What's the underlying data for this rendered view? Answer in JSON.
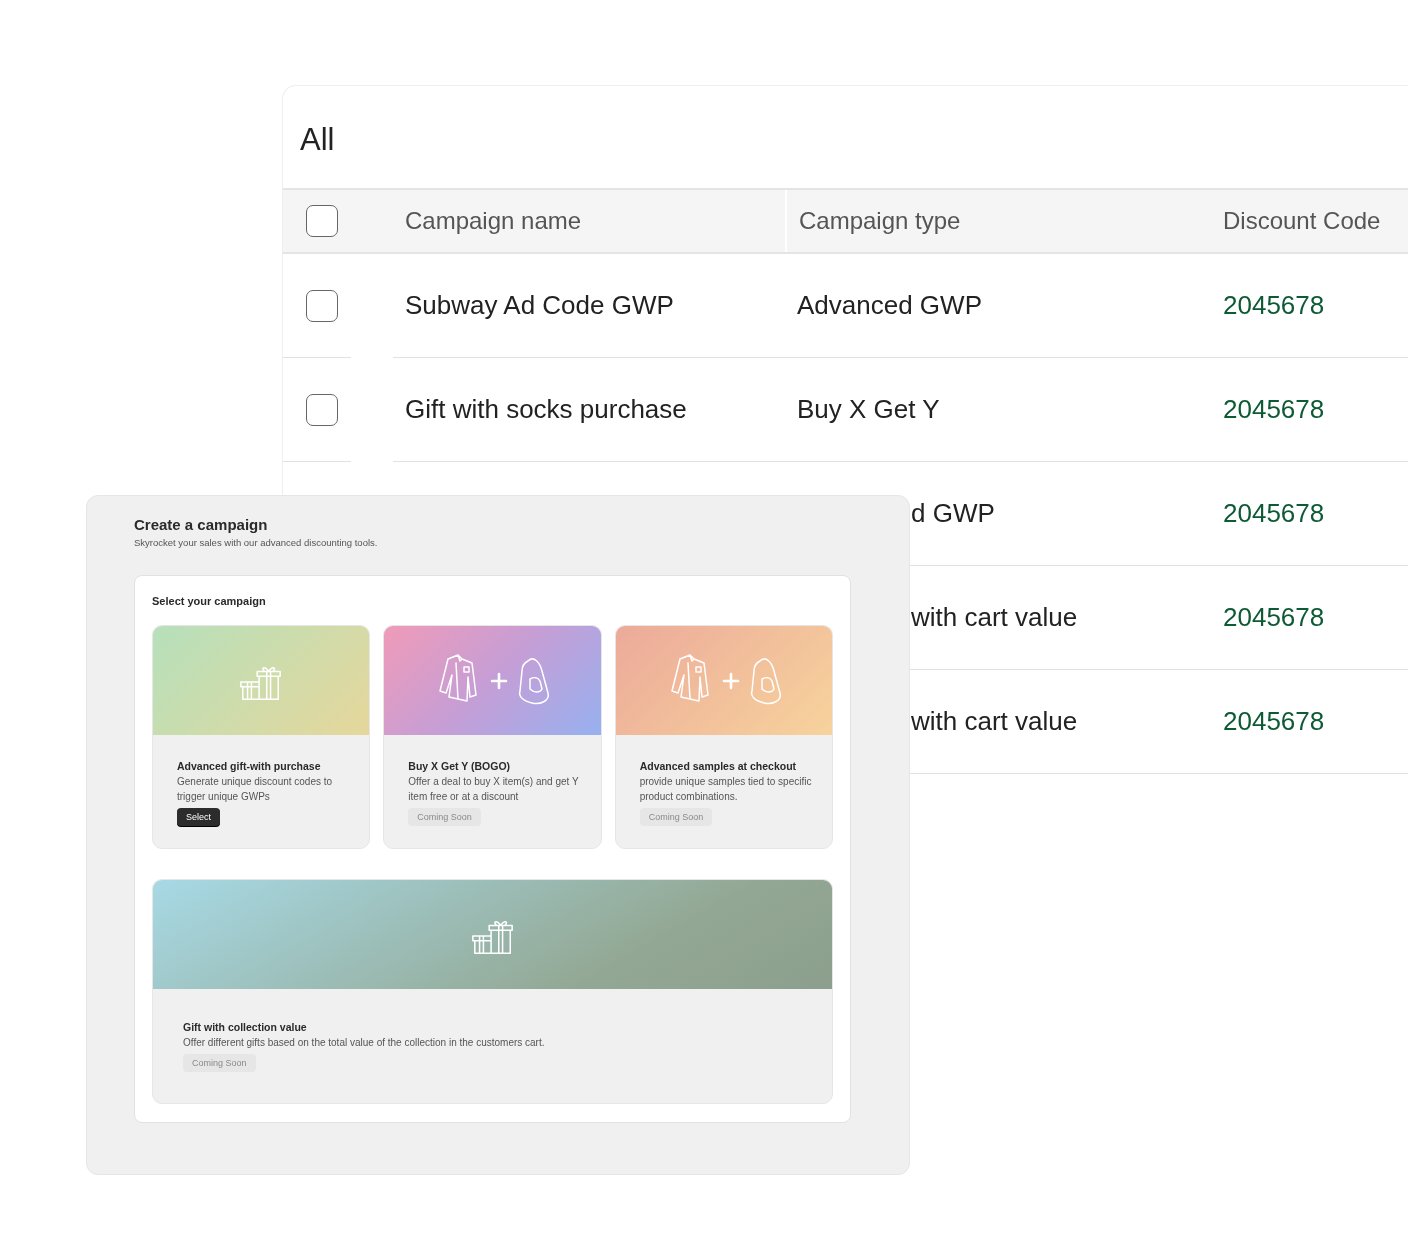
{
  "table": {
    "title": "All",
    "header_checkbox": {
      "checked": false
    },
    "columns": [
      "Campaign name",
      "Campaign type",
      "Discount Code"
    ],
    "rows": [
      {
        "kind": "full",
        "checked": false,
        "name": "Subway Ad Code GWP",
        "type": "Advanced GWP",
        "code": "2045678"
      },
      {
        "kind": "full",
        "checked": false,
        "name": "Gift with socks purchase",
        "type": "Buy X Get Y",
        "code": "2045678"
      },
      {
        "kind": "partial",
        "type": "d GWP",
        "code": "2045678"
      },
      {
        "kind": "partial",
        "type": "with cart value",
        "code": "2045678"
      },
      {
        "kind": "partial",
        "type": "with cart value",
        "code": "2045678"
      }
    ]
  },
  "dialog": {
    "title": "Create a campaign",
    "subtitle": "Skyrocket your sales with our advanced discounting tools.",
    "section_title": "Select your campaign",
    "campaigns": [
      {
        "kind": "gift",
        "title": "Advanced gift-with purchase",
        "description": "Generate unique discount codes to trigger unique GWPs",
        "button": "Select",
        "disabled": false
      },
      {
        "kind": "shirt-bag",
        "title": "Buy X Get Y (BOGO)",
        "description": "Offer a deal to buy X item(s) and get Y item free or at a discount",
        "button": "Coming Soon",
        "disabled": true
      },
      {
        "kind": "shirt-bag",
        "title": "Advanced samples at checkout",
        "description": "provide unique samples tied to specific product combinations.",
        "button": "Coming Soon",
        "disabled": true
      },
      {
        "kind": "gift",
        "title": "Gift with collection value",
        "description": "Offer different gifts based on the total value of the collection in the customers cart.",
        "button": "Coming Soon",
        "disabled": true
      }
    ]
  }
}
